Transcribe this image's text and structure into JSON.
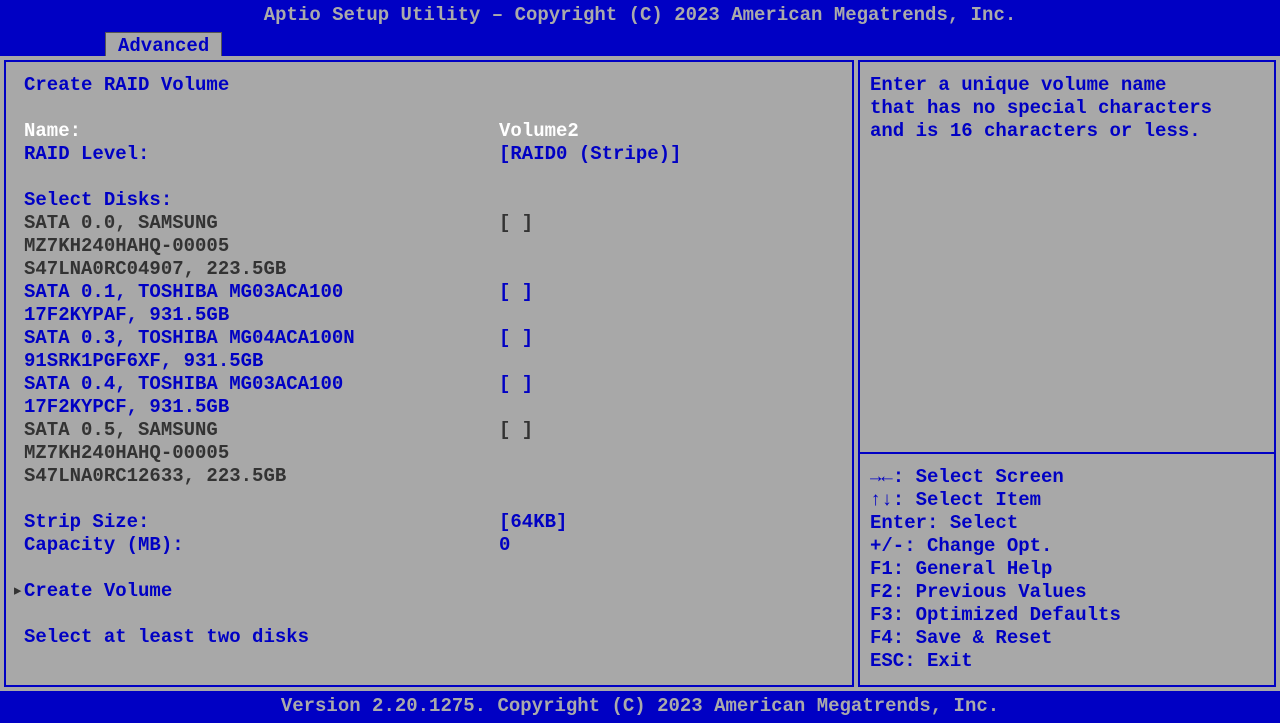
{
  "header": {
    "title": "Aptio Setup Utility – Copyright (C) 2023 American Megatrends, Inc."
  },
  "tab": {
    "active": "Advanced"
  },
  "main": {
    "section_title": "Create RAID Volume",
    "name_label": "Name:",
    "name_value": "Volume2",
    "raid_level_label": "RAID Level:",
    "raid_level_value": "[RAID0 (Stripe)]",
    "select_disks_label": "Select Disks:",
    "disks": [
      {
        "line1": "SATA 0.0, SAMSUNG",
        "line2": "MZ7KH240HAHQ-00005",
        "line3": "S47LNA0RC04907, 223.5GB",
        "checkbox": "[ ]",
        "selectable": false
      },
      {
        "line1": "SATA 0.1, TOSHIBA MG03ACA100",
        "line2": "17F2KYPAF, 931.5GB",
        "checkbox": "[ ]",
        "selectable": true
      },
      {
        "line1": "SATA 0.3, TOSHIBA MG04ACA100N",
        "line2": "91SRK1PGF6XF, 931.5GB",
        "checkbox": "[ ]",
        "selectable": true
      },
      {
        "line1": "SATA 0.4, TOSHIBA MG03ACA100",
        "line2": "17F2KYPCF, 931.5GB",
        "checkbox": "[ ]",
        "selectable": true
      },
      {
        "line1": "SATA 0.5, SAMSUNG",
        "line2": "MZ7KH240HAHQ-00005",
        "line3": "S47LNA0RC12633, 223.5GB",
        "checkbox": "[ ]",
        "selectable": false
      }
    ],
    "strip_size_label": "Strip Size:",
    "strip_size_value": "[64KB]",
    "capacity_label": "Capacity (MB):",
    "capacity_value": "0",
    "create_volume_label": "Create Volume",
    "marker": "▸",
    "hint_text": "Select at least two disks"
  },
  "help": {
    "line1": "Enter a unique volume name",
    "line2": "that has no special characters",
    "line3": "and is 16 characters or less."
  },
  "keys": {
    "k1": "→←: Select Screen",
    "k2": "↑↓: Select Item",
    "k3": "Enter: Select",
    "k4": "+/-: Change Opt.",
    "k5": "F1: General Help",
    "k6": "F2: Previous Values",
    "k7": "F3: Optimized Defaults",
    "k8": "F4: Save & Reset",
    "k9": "ESC: Exit"
  },
  "footer": {
    "text": "Version 2.20.1275. Copyright (C) 2023 American Megatrends, Inc."
  }
}
